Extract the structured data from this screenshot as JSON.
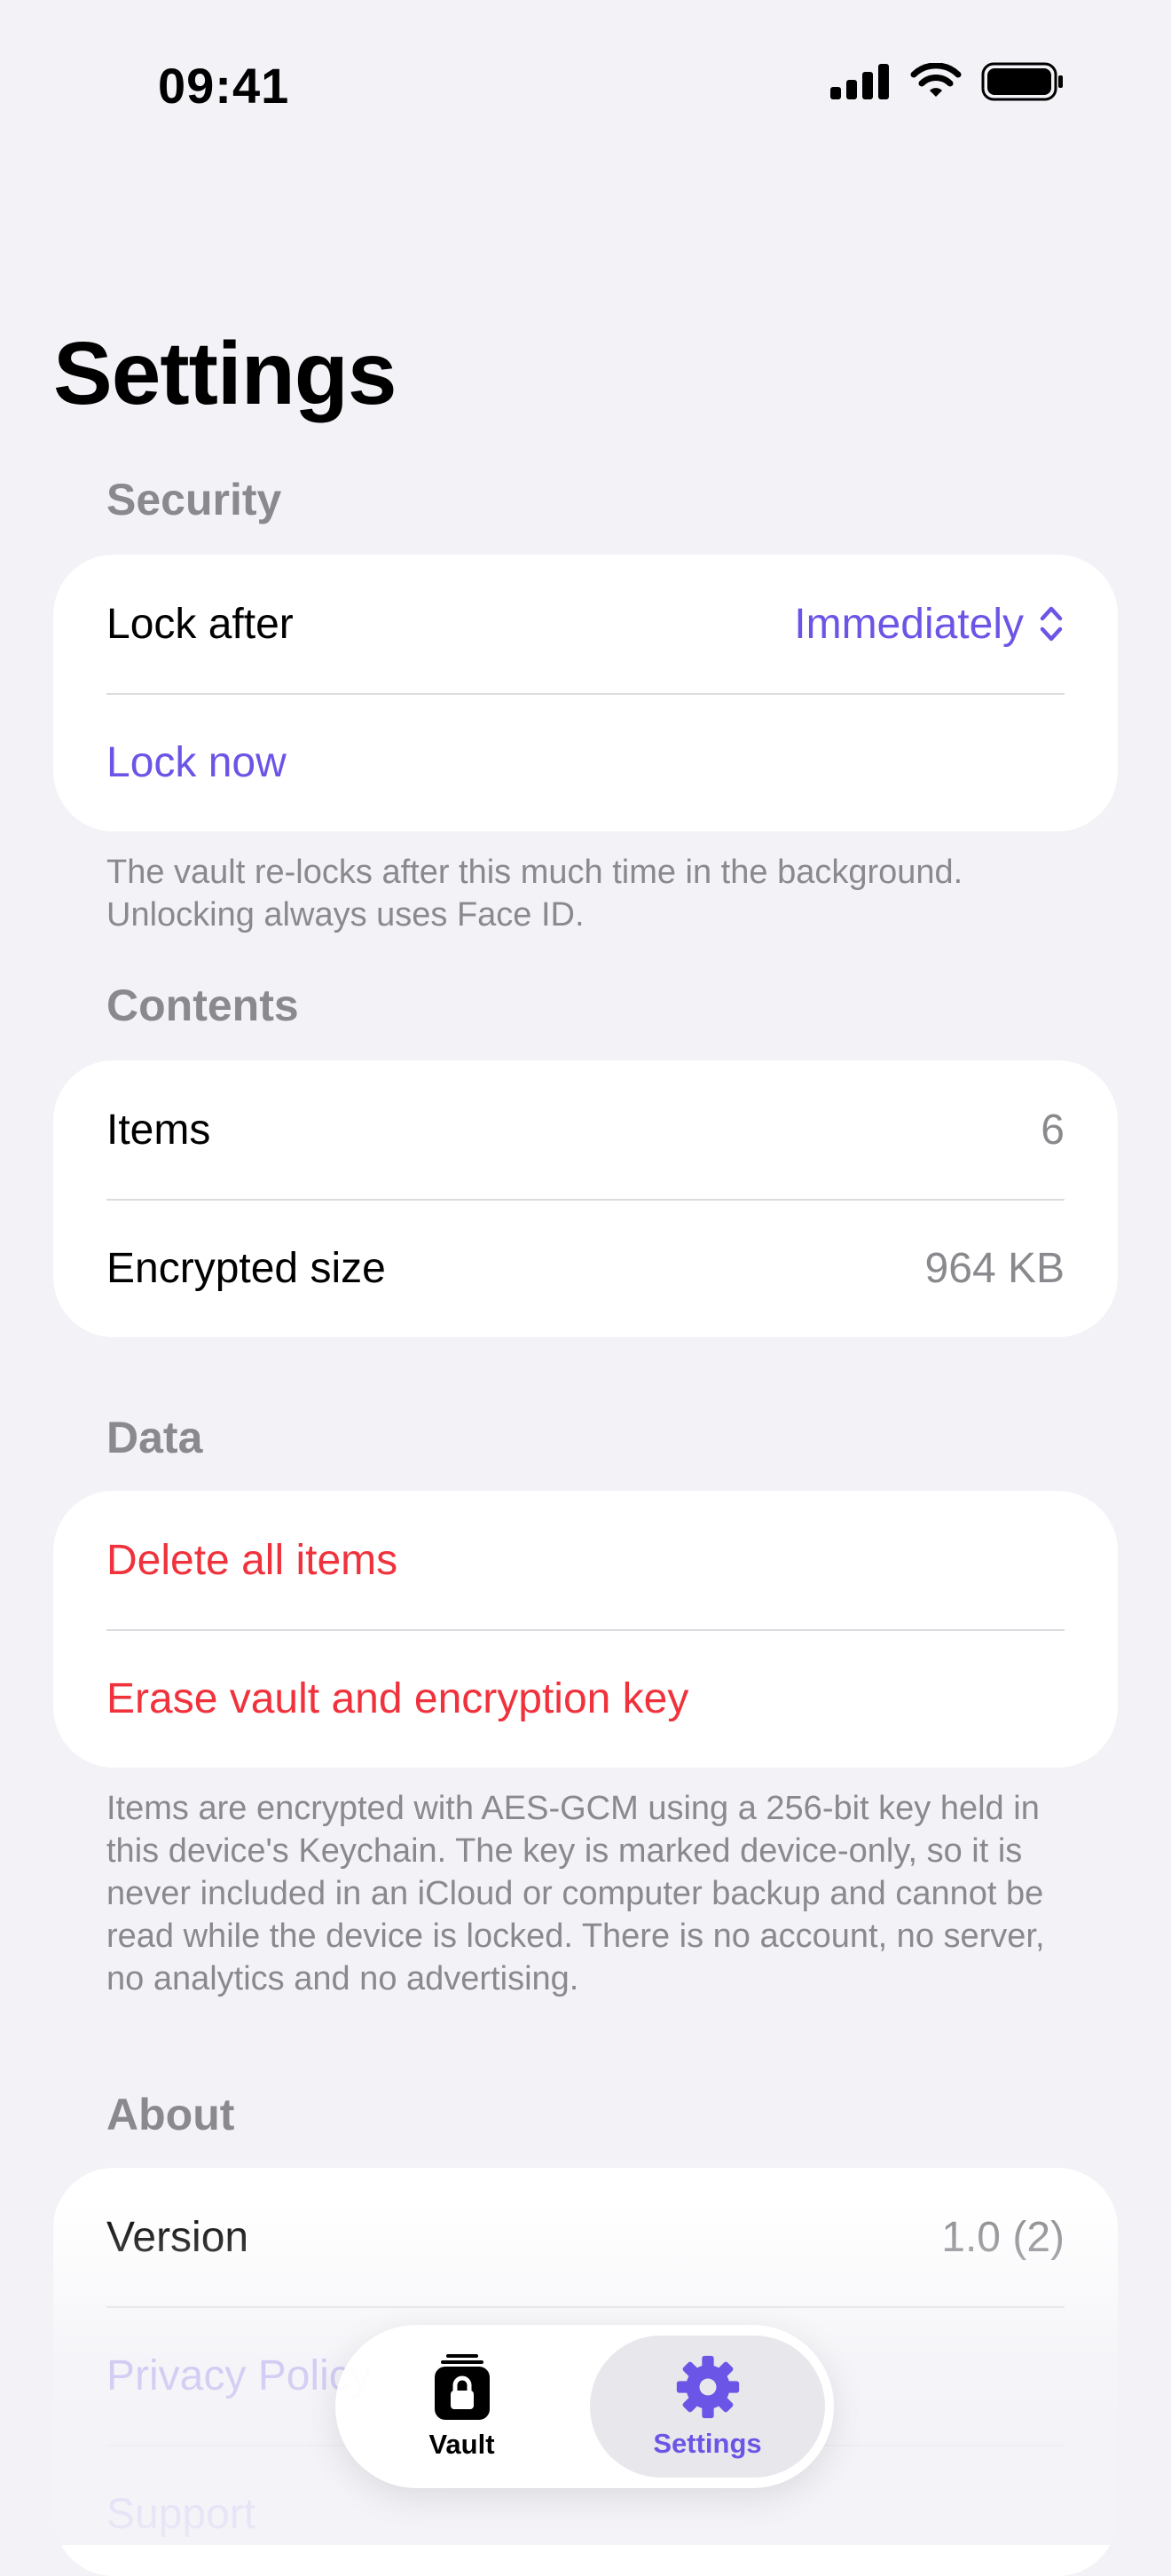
{
  "status_bar": {
    "time": "09:41"
  },
  "page": {
    "title": "Settings"
  },
  "sections": {
    "security": {
      "header": "Security",
      "lock_after_label": "Lock after",
      "lock_after_value": "Immediately",
      "lock_now_label": "Lock now",
      "footer": "The vault re-locks after this much time in the background. Unlocking always uses Face ID."
    },
    "contents": {
      "header": "Contents",
      "items_label": "Items",
      "items_value": "6",
      "size_label": "Encrypted size",
      "size_value": "964 KB"
    },
    "data": {
      "header": "Data",
      "delete_label": "Delete all items",
      "erase_label": "Erase vault and encryption key",
      "footer": "Items are encrypted with AES-GCM using a 256-bit key held in this device's Keychain. The key is marked device-only, so it is never included in an iCloud or computer backup and cannot be read while the device is locked. There is no account, no server, no analytics and no advertising."
    },
    "about": {
      "header": "About",
      "version_label": "Version",
      "version_value": "1.0 (2)",
      "privacy_label": "Privacy Policy",
      "support_label": "Support"
    }
  },
  "tab_bar": {
    "vault_label": "Vault",
    "settings_label": "Settings",
    "selected": "Settings"
  },
  "icons": {
    "signal": "cellular-signal-icon",
    "wifi": "wifi-icon",
    "battery": "battery-icon",
    "picker": "chevron-up-down-icon",
    "vault": "lock-icon",
    "settings": "gear-icon"
  },
  "colors": {
    "accent": "#6b55e6",
    "destructive": "#f0323c",
    "secondary_text": "#8a8a8e",
    "background": "#f2f2f7"
  }
}
